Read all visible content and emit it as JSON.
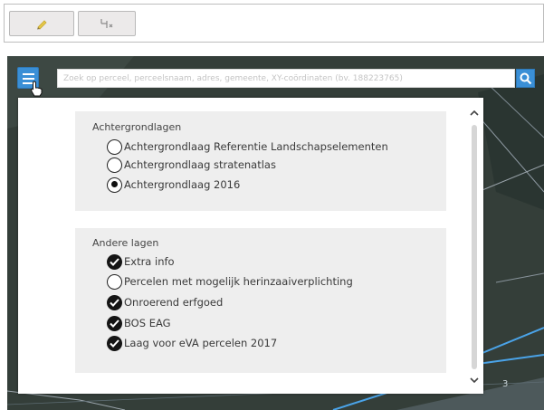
{
  "toolbar": {
    "buttons": [
      {
        "icon": "pencil-icon"
      },
      {
        "icon": "measure-line-icon"
      }
    ]
  },
  "search": {
    "placeholder": "Zoek op perceel, perceelsnaam, adres, gemeente, XY-coördinaten (bv. 188223765)",
    "menu_icon": "hamburger-menu-icon",
    "search_icon": "search-icon"
  },
  "panel": {
    "background_group": {
      "title": "Achtergrondlagen",
      "layers": [
        {
          "label": "Achtergrondlaag Referentie Landschapselementen",
          "selected": false
        },
        {
          "label": "Achtergrondlaag stratenatlas",
          "selected": false
        },
        {
          "label": "Achtergrondlaag 2016",
          "selected": true
        }
      ]
    },
    "other_group": {
      "title": "Andere lagen",
      "layers": [
        {
          "label": "Extra info",
          "checked": true
        },
        {
          "label": "Percelen met mogelijk herinzaaiverplichting",
          "checked": false
        },
        {
          "label": "Onroerend erfgoed",
          "checked": true
        },
        {
          "label": "BOS EAG",
          "checked": true
        },
        {
          "label": "Laag voor eVA percelen 2017",
          "checked": true
        }
      ]
    }
  },
  "map": {
    "parcel_number": "3"
  },
  "colors": {
    "accent": "#3a8fd6",
    "panel_group_bg": "#eeeeee",
    "map_bg": "#2f3a36",
    "parcel_outline": "#4aa3e8"
  }
}
